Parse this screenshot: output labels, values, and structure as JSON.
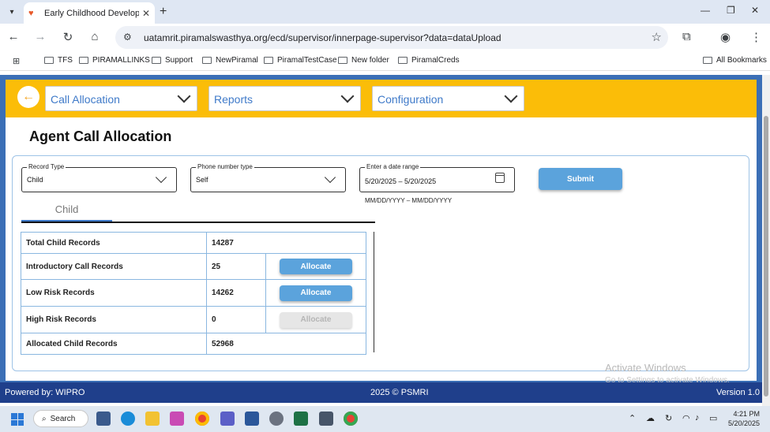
{
  "browser": {
    "tab_title": "Early Childhood Developmen",
    "url": "uatamrit.piramalswasthya.org/ecd/supervisor/innerpage-supervisor?data=dataUpload",
    "bookmarks": [
      "TFS",
      "PIRAMALLINKS",
      "Support",
      "NewPiramal",
      "PiramalTestCase",
      "New folder",
      "PiramalCreds"
    ],
    "all_bookmarks": "All Bookmarks"
  },
  "nav": {
    "menus": [
      "Call Allocation",
      "Reports",
      "Configuration"
    ]
  },
  "main": {
    "title": "Agent Call Allocation",
    "record_type": {
      "label": "Record Type",
      "value": "Child"
    },
    "phone_type": {
      "label": "Phone number type",
      "value": "Self"
    },
    "date_range": {
      "label": "Enter a date range",
      "value": "5/20/2025 – 5/20/2025",
      "hint": "MM/DD/YYYY – MM/DD/YYYY"
    },
    "submit_label": "Submit",
    "tab_label": "Child",
    "rows": [
      {
        "label": "Total Child Records",
        "value": "14287",
        "action": null
      },
      {
        "label": "Introductory Call Records",
        "value": "25",
        "action": "Allocate",
        "enabled": true
      },
      {
        "label": "Low Risk Records",
        "value": "14262",
        "action": "Allocate",
        "enabled": true
      },
      {
        "label": "High Risk Records",
        "value": "0",
        "action": "Allocate",
        "enabled": false
      },
      {
        "label": "Allocated Child Records",
        "value": "52968",
        "action": null
      }
    ]
  },
  "footer": {
    "powered": "Powered by: WIPRO",
    "copyright": "2025 © PSMRI",
    "version": "Version 1.0"
  },
  "watermark": {
    "title": "Activate Windows",
    "sub": "Go to Settings to activate Windows."
  },
  "taskbar": {
    "search": "Search",
    "time": "4:21 PM",
    "date": "5/20/2025"
  },
  "colors": {
    "header_yellow": "#fbbd08",
    "page_blue": "#3b6fb6",
    "footer_navy": "#1f3f8b",
    "button_blue": "#5ba3dc"
  }
}
